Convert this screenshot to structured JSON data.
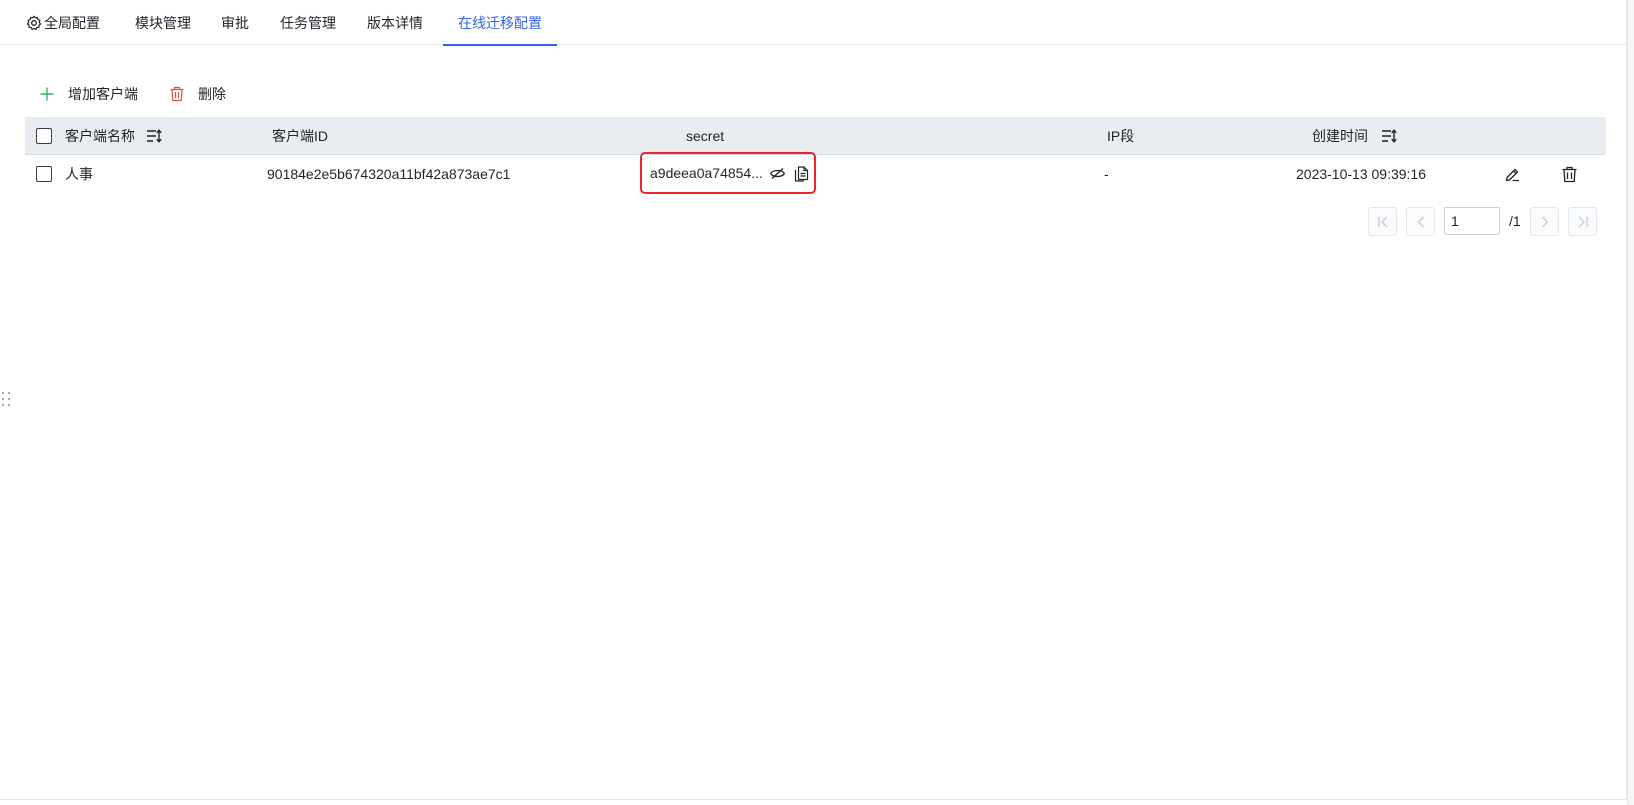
{
  "tabs": [
    {
      "label": "全局配置",
      "icon": "gear-icon"
    },
    {
      "label": "模块管理"
    },
    {
      "label": "审批"
    },
    {
      "label": "任务管理"
    },
    {
      "label": "版本详情"
    },
    {
      "label": "在线迁移配置",
      "active": true
    }
  ],
  "toolbar": {
    "add_label": "增加客户端",
    "add_icon": "plus-icon",
    "delete_label": "删除",
    "delete_icon": "trash-icon"
  },
  "table": {
    "columns": [
      "客户端名称",
      "客户端ID",
      "secret",
      "IP段",
      "创建时间"
    ],
    "sortable_columns": [
      "客户端名称",
      "创建时间"
    ],
    "rows": [
      {
        "name": "人事",
        "client_id": "90184e2e5b674320a11bf42a873ae7c1",
        "secret": "a9deea0a74854...",
        "ip": "-",
        "created": "2023-10-13 09:39:16",
        "actions": [
          "edit-icon",
          "trash-icon"
        ]
      }
    ]
  },
  "pagination": {
    "current_page": "1",
    "total_label": "/1"
  },
  "colors": {
    "accent": "#3366e0",
    "highlight_border": "#e8282b",
    "add_icon": "#2fb86a",
    "delete_icon": "#e24d4d",
    "header_bg": "#e9ecf1"
  }
}
